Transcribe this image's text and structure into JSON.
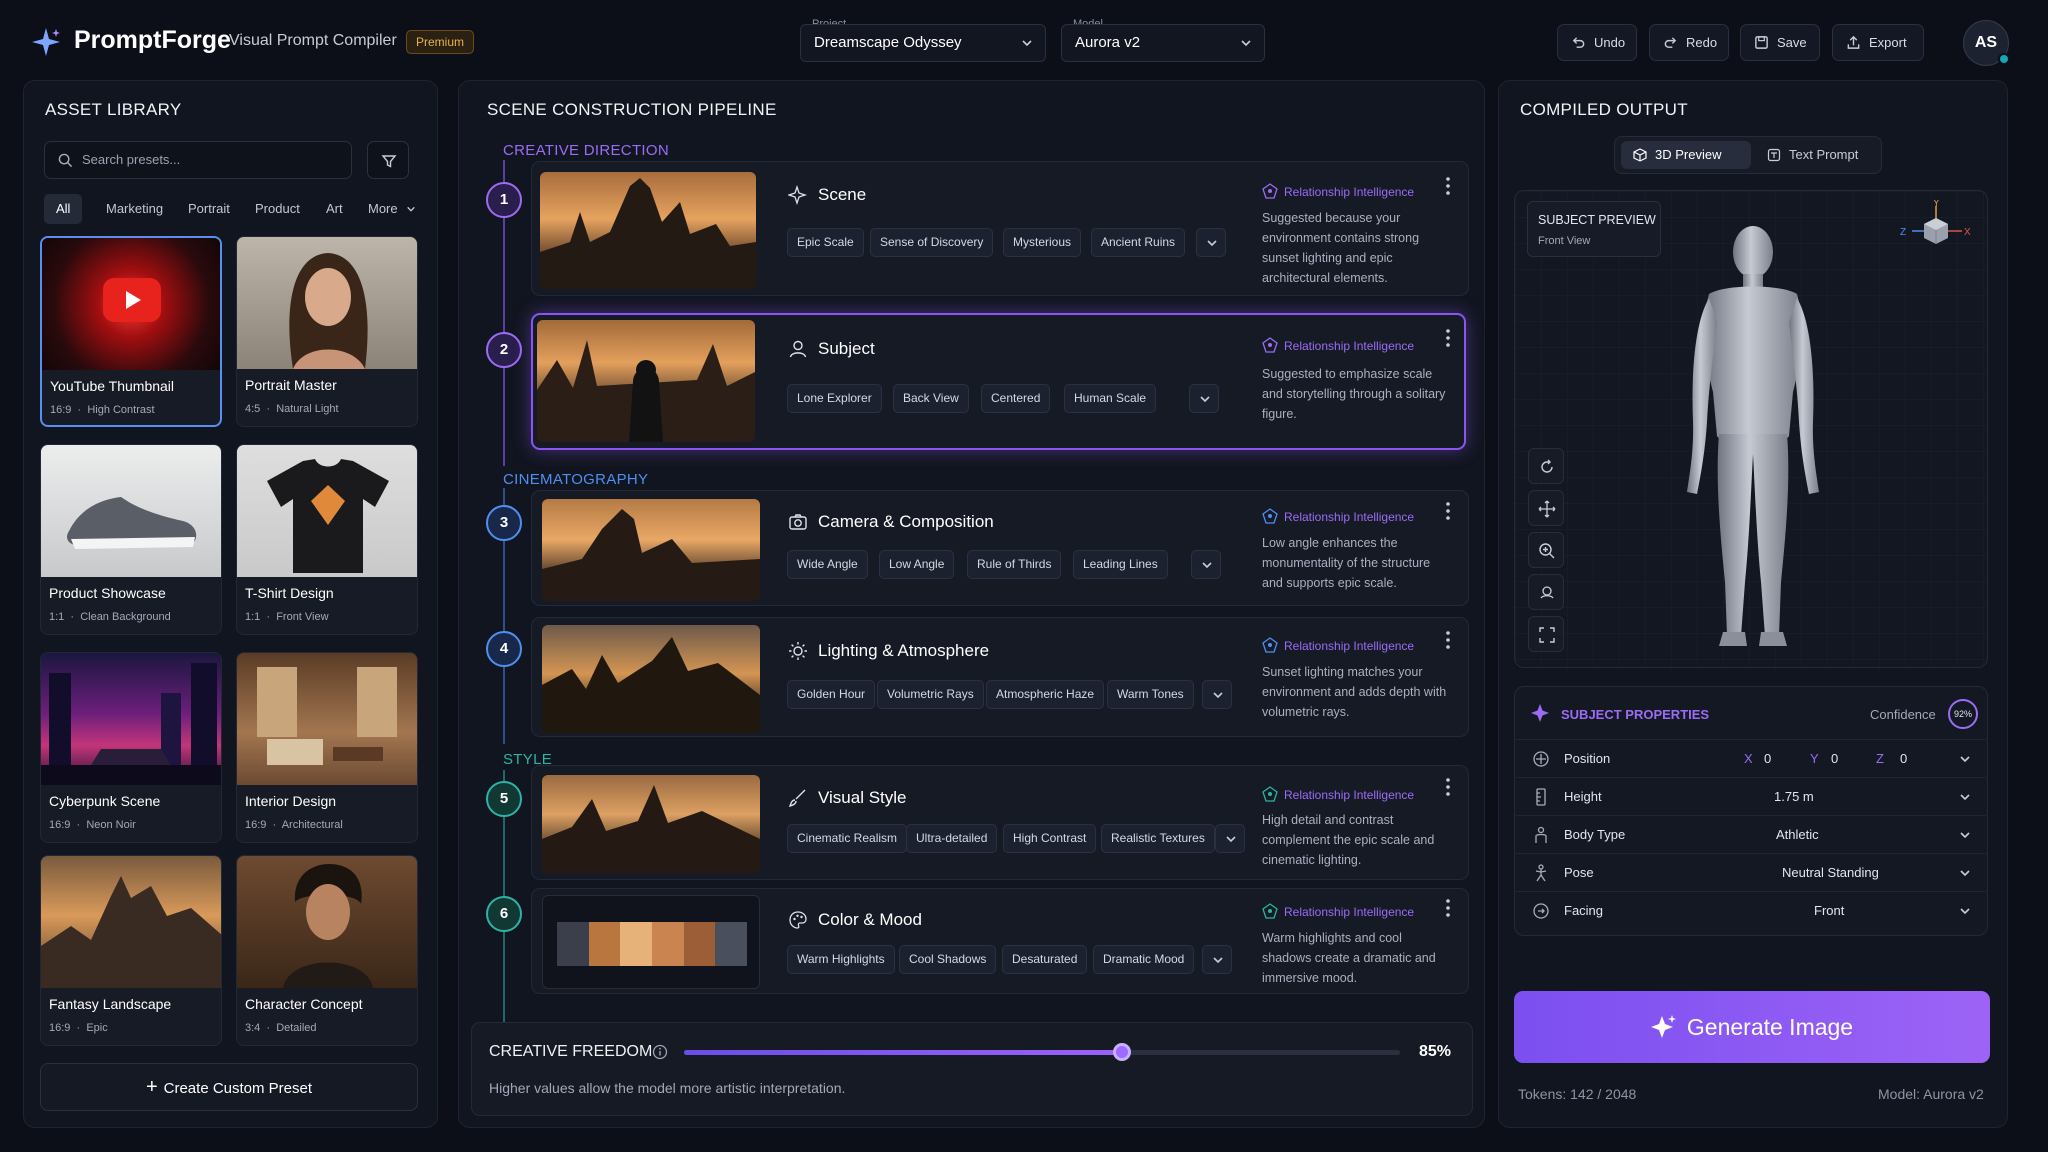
{
  "app": {
    "brand": "PromptForge",
    "subtitle": "Visual Prompt Compiler",
    "badge": "Premium",
    "user_initials": "AS"
  },
  "header": {
    "project_label": "Project",
    "project_value": "Dreamscape Odyssey",
    "model_label": "Model",
    "model_value": "Aurora v2",
    "undo": "Undo",
    "redo": "Redo",
    "save": "Save",
    "export": "Export"
  },
  "library": {
    "title": "ASSET LIBRARY",
    "search_placeholder": "Search presets...",
    "categories": [
      "All",
      "Marketing",
      "Portrait",
      "Product",
      "Art",
      "More"
    ],
    "presets": [
      {
        "title": "YouTube Thumbnail",
        "ratio": "16:9",
        "meta": "High Contrast"
      },
      {
        "title": "Portrait Master",
        "ratio": "4:5",
        "meta": "Natural Light"
      },
      {
        "title": "Product Showcase",
        "ratio": "1:1",
        "meta": "Clean Background"
      },
      {
        "title": "T-Shirt Design",
        "ratio": "1:1",
        "meta": "Front View"
      },
      {
        "title": "Cyberpunk Scene",
        "ratio": "16:9",
        "meta": "Neon Noir"
      },
      {
        "title": "Interior Design",
        "ratio": "16:9",
        "meta": "Architectural"
      },
      {
        "title": "Fantasy Landscape",
        "ratio": "16:9",
        "meta": "Epic"
      },
      {
        "title": "Character Concept",
        "ratio": "3:4",
        "meta": "Detailed"
      }
    ],
    "create_button": "Create Custom Preset"
  },
  "pipeline": {
    "title": "SCENE CONSTRUCTION PIPELINE",
    "sections": {
      "creative": "CREATIVE DIRECTION",
      "cinema": "CINEMATOGRAPHY",
      "style": "STYLE"
    },
    "rel_label": "Relationship Intelligence",
    "steps": [
      {
        "num": "1",
        "name": "Scene",
        "tags": [
          "Epic Scale",
          "Sense of Discovery",
          "Mysterious",
          "Ancient Ruins"
        ],
        "desc": "Suggested because your environment contains strong sunset lighting and epic architectural elements."
      },
      {
        "num": "2",
        "name": "Subject",
        "tags": [
          "Lone Explorer",
          "Back View",
          "Centered",
          "Human Scale"
        ],
        "desc": "Suggested to emphasize scale and storytelling through a solitary figure."
      },
      {
        "num": "3",
        "name": "Camera & Composition",
        "tags": [
          "Wide Angle",
          "Low Angle",
          "Rule of Thirds",
          "Leading Lines"
        ],
        "desc": "Low angle enhances the monumentality of the structure and supports epic scale."
      },
      {
        "num": "4",
        "name": "Lighting & Atmosphere",
        "tags": [
          "Golden Hour",
          "Volumetric Rays",
          "Atmospheric Haze",
          "Warm Tones"
        ],
        "desc": "Sunset lighting matches your environment and adds depth with volumetric rays."
      },
      {
        "num": "5",
        "name": "Visual Style",
        "tags": [
          "Cinematic Realism",
          "Ultra-detailed",
          "High Contrast",
          "Realistic Textures"
        ],
        "desc": "High detail and contrast complement the epic scale and cinematic lighting."
      },
      {
        "num": "6",
        "name": "Color & Mood",
        "tags": [
          "Warm Highlights",
          "Cool Shadows",
          "Desaturated",
          "Dramatic Mood"
        ],
        "desc": "Warm highlights and cool shadows create a dramatic and immersive mood."
      }
    ],
    "palette": [
      "#3a3f4b",
      "#b9773f",
      "#e7b27a",
      "#c9844f",
      "#9b5e36",
      "#4a4f5d"
    ],
    "freedom_label": "CREATIVE FREEDOM",
    "freedom_value": 85,
    "freedom_text": "85%",
    "freedom_hint": "Higher values allow the model more artistic interpretation."
  },
  "output": {
    "title": "COMPILED OUTPUT",
    "tab_preview": "3D Preview",
    "tab_text": "Text Prompt",
    "preview_title": "SUBJECT PREVIEW",
    "preview_view": "Front View",
    "gizmo": {
      "y": "Y",
      "z": "Z",
      "x": "X"
    },
    "props_title": "SUBJECT PROPERTIES",
    "confidence_label": "Confidence",
    "confidence_value": "92%",
    "position": {
      "label": "Position",
      "x_label": "X",
      "x": "0",
      "y_label": "Y",
      "y": "0",
      "z_label": "Z",
      "z": "0"
    },
    "height": {
      "label": "Height",
      "value": "1.75 m"
    },
    "body": {
      "label": "Body Type",
      "value": "Athletic"
    },
    "pose": {
      "label": "Pose",
      "value": "Neutral Standing"
    },
    "facing": {
      "label": "Facing",
      "value": "Front"
    },
    "generate": "Generate Image",
    "tokens": "Tokens: 142 / 2048",
    "model": "Model: Aurora v2"
  },
  "colors": {
    "accent": "#8a55f0",
    "creative": "#9b6cf4",
    "cinema": "#4f8ff0",
    "style": "#2bb3a5"
  }
}
